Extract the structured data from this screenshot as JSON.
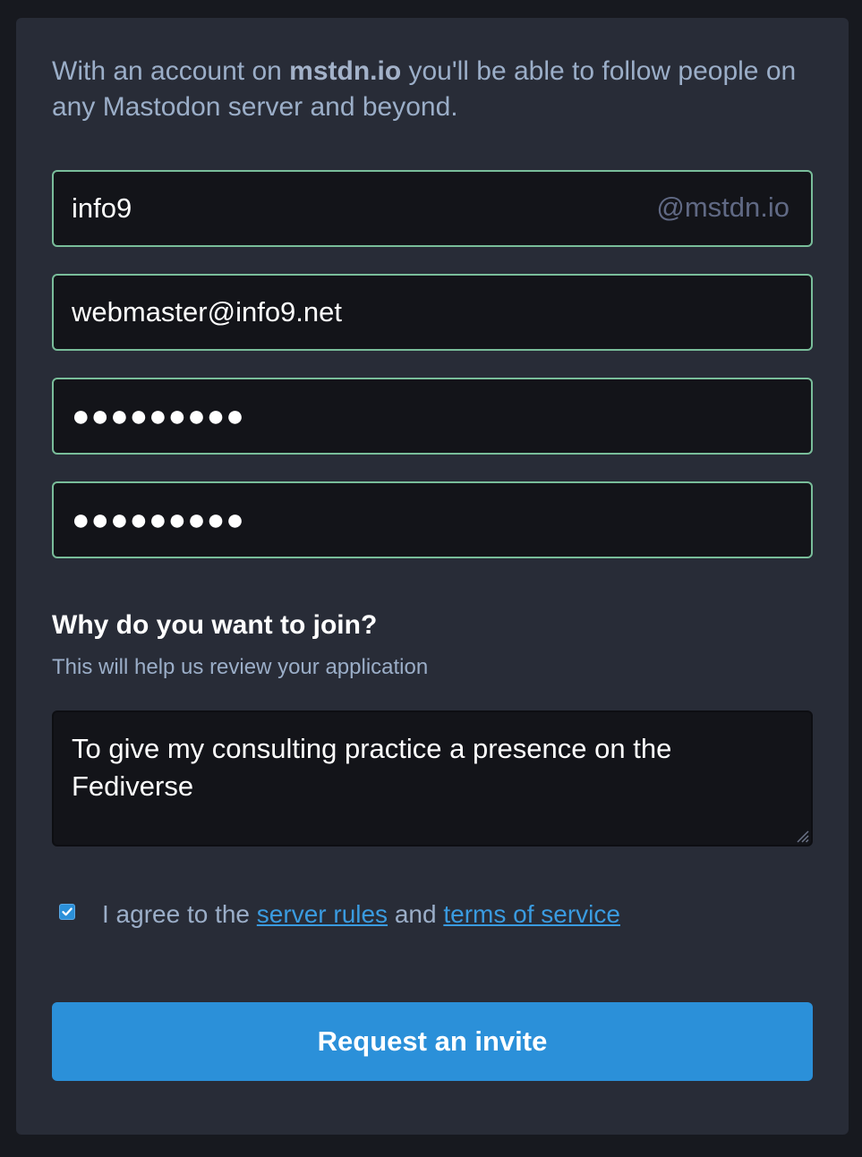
{
  "intro": {
    "prefix": "With an account on ",
    "domain": "mstdn.io",
    "suffix": " you'll be able to follow people on any Mastodon server and beyond."
  },
  "form": {
    "username_value": "info9",
    "username_suffix": "@mstdn.io",
    "email_value": "webmaster@info9.net",
    "password_value": "●●●●●●●●●",
    "password_confirm_value": "●●●●●●●●●",
    "question_label": "Why do you want to join?",
    "question_hint": "This will help us review your application",
    "reason_value": "To give my consulting practice a presence on the Fediverse",
    "agreement": {
      "checked": true,
      "prefix": "I agree to the ",
      "rules_link": "server rules",
      "middle": " and ",
      "tos_link": "terms of service"
    },
    "submit_label": "Request an invite"
  },
  "colors": {
    "page_bg": "#17191f",
    "card_bg": "#282c37",
    "input_bg": "#131419",
    "input_border_valid": "#79bd9a",
    "accent": "#2b90d9",
    "secondary_text": "#9baec8"
  }
}
